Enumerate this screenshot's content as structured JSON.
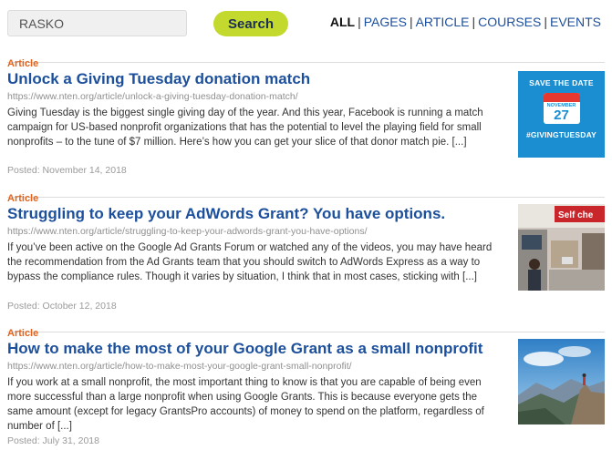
{
  "search": {
    "value": "RASKO",
    "button_label": "Search"
  },
  "filters": [
    {
      "label": "ALL",
      "active": true
    },
    {
      "label": "PAGES",
      "active": false
    },
    {
      "label": "ARTICLE",
      "active": false
    },
    {
      "label": "COURSES",
      "active": false
    },
    {
      "label": "EVENTS",
      "active": false
    }
  ],
  "results": [
    {
      "type": "Article",
      "title": "Unlock a Giving Tuesday donation match",
      "url": "https://www.nten.org/article/unlock-a-giving-tuesday-donation-match/",
      "excerpt": "Giving Tuesday is the biggest single giving day of the year. And this year, Facebook is running a match campaign for US-based nonprofit organizations that has the potential to level the playing field for small nonprofits – to the tune of $7 million. Here’s how you can get your slice of that donor match pie. [...]",
      "date": "Posted: November 14, 2018",
      "thumb": {
        "top_text": "SAVE THE DATE",
        "month": "NOVEMBER",
        "day": "27",
        "tag": "#GIVINGTUESDAY"
      }
    },
    {
      "type": "Article",
      "title": "Struggling to keep your AdWords Grant? You have options.",
      "url": "https://www.nten.org/article/struggling-to-keep-your-adwords-grant-you-have-options/",
      "excerpt": "If you’ve been active on the Google Ad Grants Forum or watched any of the videos, you may have heard the recommendation from the Ad Grants team that you should switch to AdWords Express as a way to bypass the compliance rules. Though it varies by situation, I think that in most cases, sticking with [...]",
      "date": "Posted: October 12, 2018",
      "thumb": {
        "sign_text": "Self che"
      }
    },
    {
      "type": "Article",
      "title": "How to make the most of your Google Grant as a small nonprofit",
      "url": "https://www.nten.org/article/how-to-make-most-your-google-grant-small-nonprofit/",
      "excerpt": "If you work at a small nonprofit, the most important thing to know is that you are capable of being even more successful than a large nonprofit when using Google Grants. This is because everyone gets the same amount (except for legacy GrantsPro accounts) of money to spend on the platform, regardless of number of [...]",
      "date": "Posted: July 31, 2018"
    }
  ]
}
